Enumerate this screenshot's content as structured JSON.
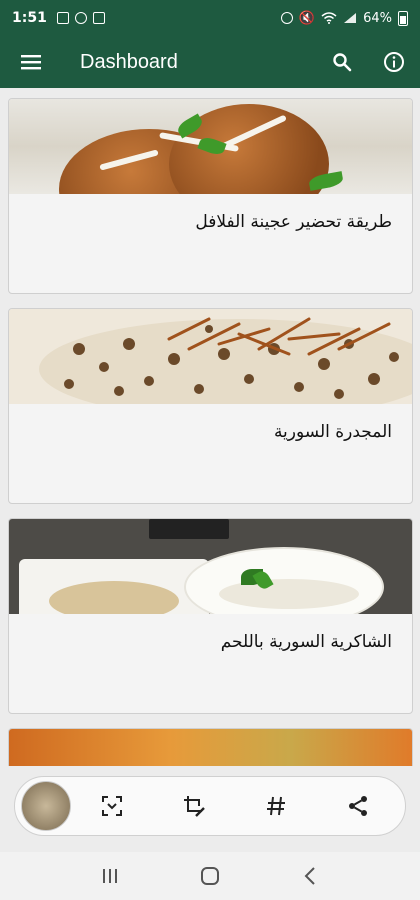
{
  "status_bar": {
    "time": "1:51",
    "battery": "64%"
  },
  "app_bar": {
    "title": "Dashboard",
    "icons": [
      "menu-icon",
      "search-icon",
      "info-icon"
    ]
  },
  "recipes": [
    {
      "title": "طريقة تحضير عجينة الفلافل",
      "image": "falafel-image"
    },
    {
      "title": "المجدرة السورية",
      "image": "mujadara-image"
    },
    {
      "title": "الشاكرية السورية باللحم",
      "image": "shakriyeh-image"
    },
    {
      "title": "",
      "image": "dish-image"
    }
  ],
  "bottom_toolbar": {
    "icons": [
      "thumbnail-image",
      "scan-icon",
      "crop-edit-icon",
      "hashtag-icon",
      "share-icon"
    ]
  },
  "nav_bar": {
    "icons": [
      "recent-apps-icon",
      "home-icon",
      "back-icon"
    ]
  },
  "colors": {
    "primary": "#1e5a40",
    "background": "#ececec",
    "card": "#f4f4f4"
  }
}
